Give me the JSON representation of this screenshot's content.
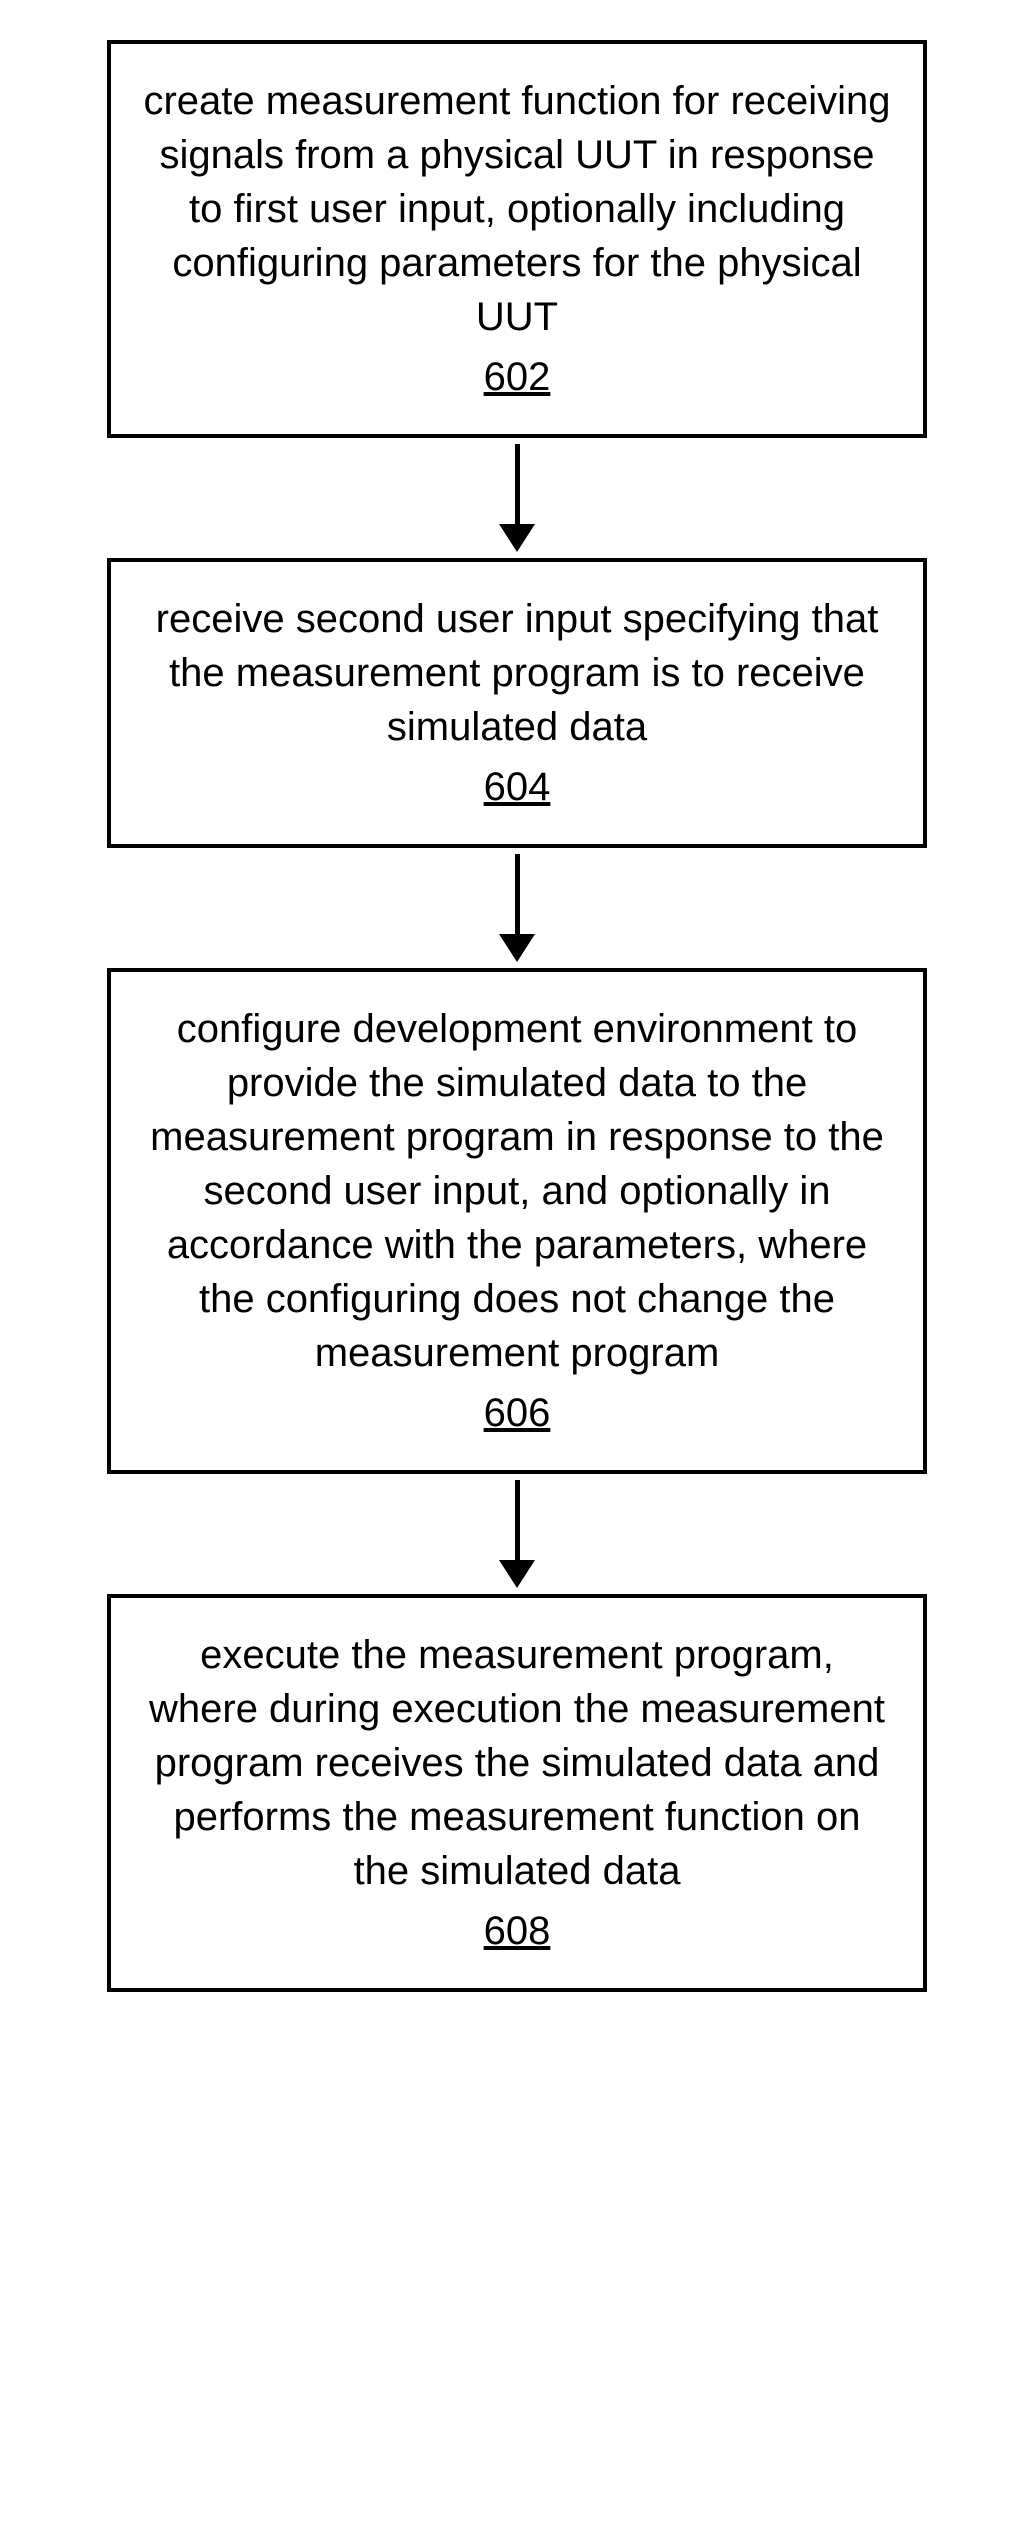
{
  "flowchart": {
    "steps": [
      {
        "text": "create measurement function for receiving signals from a physical UUT in response to first user input, optionally including configuring parameters for the physical UUT",
        "ref": "602"
      },
      {
        "text": "receive second user input specifying that the measurement program is to receive simulated data",
        "ref": "604"
      },
      {
        "text": "configure development environment to provide the simulated data to the measurement program in response to the second user input, and optionally in accordance with the parameters, where the configuring does not change the measurement program",
        "ref": "606"
      },
      {
        "text": "execute the measurement program, where during execution the measurement program receives the simulated data and performs the measurement function on the simulated data",
        "ref": "608"
      }
    ]
  }
}
